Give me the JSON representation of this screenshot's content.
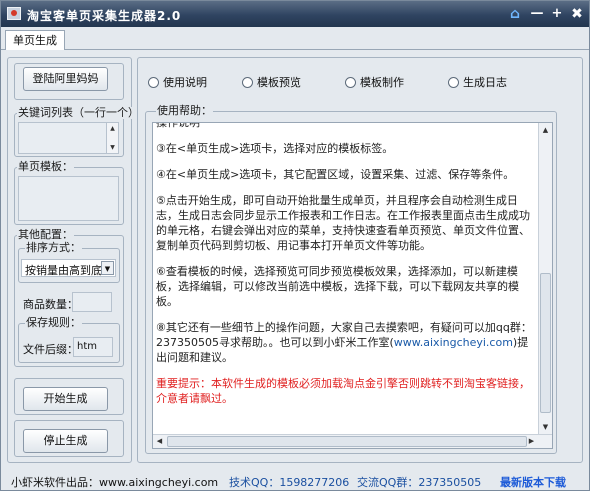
{
  "window": {
    "title": "淘宝客单页采集生成器2.0",
    "controls": {
      "home": "⌂",
      "minimize": "—",
      "maximize": "+",
      "close": "✖"
    }
  },
  "tabs": [
    {
      "label": "单页生成"
    }
  ],
  "left": {
    "login_button": "登陆阿里妈妈",
    "keywords_label": "关键词列表（一行一个）",
    "template_label": "单页模板：",
    "config_label": "其他配置：",
    "sort_label": "排序方式：",
    "sort_value": "按销量由高到底",
    "quantity_label": "商品数量：",
    "quantity_value": "",
    "save_rule_label": "保存规则：",
    "suffix_label": "文件后缀：",
    "suffix_value": "htm",
    "start_button": "开始生成",
    "stop_button": "停止生成"
  },
  "right": {
    "radios": [
      {
        "label": "使用说明",
        "checked": false
      },
      {
        "label": "模板预览",
        "checked": false
      },
      {
        "label": "模板制作",
        "checked": false
      },
      {
        "label": "生成日志",
        "checked": false
      }
    ],
    "help_label": "使用帮助：",
    "help_paragraphs": [
      {
        "text": "操作说明",
        "style": "normal"
      },
      {
        "text": "③在<单页生成>选项卡，选择对应的模板标签。",
        "style": "normal"
      },
      {
        "text": "④在<单页生成>选项卡，其它配置区域，设置采集、过滤、保存等条件。",
        "style": "normal"
      },
      {
        "text": "⑤点击开始生成，即可自动开始批量生成单页，并且程序会自动检测生成日志，生成日志会同步显示工作报表和工作日志。在工作报表里面点击生成成功的单元格，右键会弹出对应的菜单，支持快速查看单页预览、单页文件位置、复制单页代码到剪切板、用记事本打开单页文件等功能。",
        "style": "normal"
      },
      {
        "text": "⑥查看模板的时候，选择预览可同步预览模板效果，选择添加，可以新建模板，选择编辑，可以修改当前选中模板，选择下载，可以下载网友共享的模板。",
        "style": "normal"
      },
      {
        "text_before": "⑧其它还有一些细节上的操作问题，大家自己去摸索吧，有疑问可以加qq群：237350505寻求帮助。。也可以到小虾米工作室(",
        "link": "www.aixingcheyi.com",
        "text_after": ")提出问题和建议。",
        "style": "mixed"
      },
      {
        "text": "重要提示：本软件生成的模板必须加载淘点金引擎否则跳转不到淘宝客链接，介意者请飘过。",
        "style": "red"
      }
    ]
  },
  "status": {
    "publisher": "小虾米软件出品：www.aixingcheyi.com",
    "tech_qq": "技术QQ：1598277206",
    "group_qq": "交流QQ群：237350505",
    "download": "最新版本下载"
  }
}
